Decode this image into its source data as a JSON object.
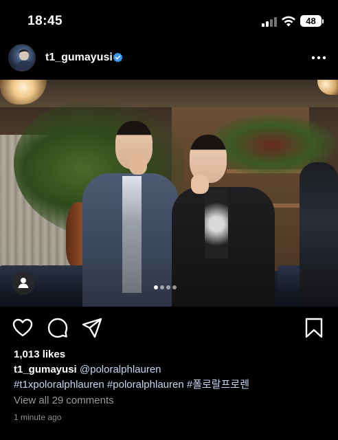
{
  "status_bar": {
    "time": "18:45",
    "battery": "48",
    "icons": [
      "cellular-signal-icon",
      "wifi-icon",
      "battery-icon"
    ]
  },
  "post": {
    "username": "t1_gumayusi",
    "verified_icon": "verified-badge-icon",
    "more_icon": "more-options-icon",
    "photo": {
      "carousel_count": 4,
      "carousel_active_index": 0,
      "tag_icon": "tagged-people-icon"
    },
    "actions": {
      "like_icon": "heart-icon",
      "comment_icon": "comment-icon",
      "share_icon": "share-icon",
      "save_icon": "bookmark-icon"
    },
    "likes": "1,013 likes",
    "caption": {
      "username": "t1_gumayusi",
      "mention": "@poloralphlauren",
      "hashtags": "#t1xpoloralphlauren #poloralphlauren #폴로랄프로렌"
    },
    "view_comments": "View all 29 comments",
    "timestamp": "1 minute ago"
  },
  "colors": {
    "background": "#000000",
    "text": "#ffffff",
    "link": "#c7d6f3",
    "muted": "#9a9a9a",
    "verified": "#3897f0"
  }
}
